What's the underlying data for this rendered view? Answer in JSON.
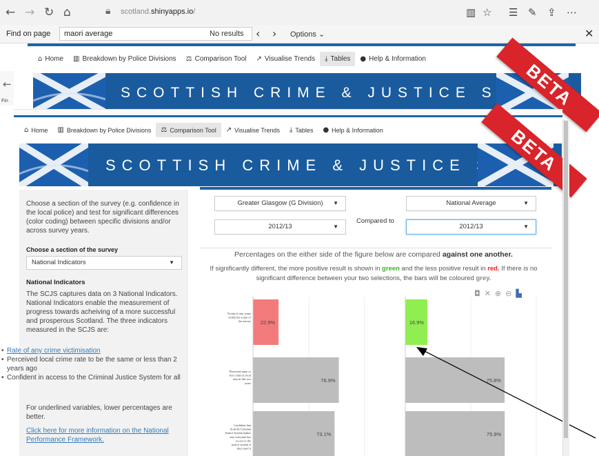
{
  "browser": {
    "url_prefix": "scotland.",
    "url_domain": "shinyapps.io",
    "url_suffix": "/",
    "nav_icons": {
      "back": "back-arrow-icon",
      "forward": "forward-arrow-icon",
      "refresh": "refresh-icon",
      "home": "home-icon",
      "lock": "lock-icon"
    },
    "right_icons": [
      "reading-view-icon",
      "favorite-star-icon",
      "favorites-list-icon",
      "pen-icon",
      "share-icon",
      "more-icon"
    ]
  },
  "find_bar": {
    "label": "Find on page",
    "query": "maori average",
    "results": "No results",
    "options": "Options"
  },
  "app": {
    "nav_items": [
      {
        "label": "Home",
        "icon": "home-icon"
      },
      {
        "label": "Breakdown by Police Divisions",
        "icon": "bar-chart-icon"
      },
      {
        "label": "Comparison Tool",
        "icon": "scales-icon"
      },
      {
        "label": "Visualise Trends",
        "icon": "line-chart-icon"
      },
      {
        "label": "Tables",
        "icon": "download-icon"
      },
      {
        "label": "Help & Information",
        "icon": "info-icon"
      }
    ],
    "banner_title": "SCOTTISH CRIME & JUSTICE SURVEY",
    "beta": "BETA",
    "left_fin": "Fin"
  },
  "sidebar": {
    "intro": "Choose a section of the survey (e.g. confidence in the local police) and test for significant differences (color coding) between specific divisions and/or across survey years.",
    "section_title": "Choose a section of the survey",
    "section_value": "National Indicators",
    "indicators_title": "National Indicators",
    "indicators_desc": "The SCJS captures data on 3 National Indicators. National Indicators enable the measurement of progress towards acheiving of a more successful and prosperous Scotland. The three indicators measured in the SCJS are:",
    "indicators": [
      "Rate of any crime victimisation",
      "Perceived local crime rate to be the same or less than 2 years ago",
      "Confident in access to the Criminal Justice System for all"
    ],
    "footnote": "For underlined variables, lower percentages are better.",
    "info_link": "Click here for more information on the National Performance Framework."
  },
  "comparison": {
    "left_area": "Greater Glasgow (G Division)",
    "left_year": "2012/13",
    "compared_label": "Compared to",
    "right_area": "National Average",
    "right_year": "2012/13",
    "note_prefix": "Percentages on the either side of the figure below are compared ",
    "note_bold": "against one another.",
    "sig_1": "If significantly different, the more positive result is shown in ",
    "sig_green": "green",
    "sig_2": " and the less positive result in ",
    "sig_red": "red.",
    "sig_3": " If there is no significant difference between your two selections, the bars will be coloured ",
    "sig_grey": "grey.",
    "toolbar_icons": [
      "camera-icon",
      "zoom-icon",
      "zoom-in-icon",
      "zoom-out-icon",
      "autoscale-icon"
    ]
  },
  "colors": {
    "brand_blue": "#1a5b9e",
    "rule_blue": "#1d63a8",
    "beta_red": "#d8242a",
    "better": "#90ee50",
    "worse": "#f47b7b",
    "no_diff": "#bdbdbd"
  },
  "chart_data": {
    "type": "bar",
    "orientation": "horizontal",
    "xlim": [
      0,
      100
    ],
    "categories": [
      "Victim of any crime within the scope of the survey",
      "Perceived same or less crime in local area in last two years",
      "Confident that Scottish Criminal Justice System makes sure everyone has access to the justice system if they need it"
    ],
    "series": [
      {
        "values": [
          22.9,
          76.9,
          73.1
        ],
        "labels": [
          "22.9%",
          "76.9%",
          "73.1%"
        ],
        "colors": [
          "#f47b7b",
          "#bdbdbd",
          "#bdbdbd"
        ]
      },
      {
        "values": [
          16.9,
          75.8,
          75.9
        ],
        "labels": [
          "16.9%",
          "75.8%",
          "75.9%"
        ],
        "colors": [
          "#90ee50",
          "#bdbdbd",
          "#bdbdbd"
        ]
      }
    ]
  }
}
